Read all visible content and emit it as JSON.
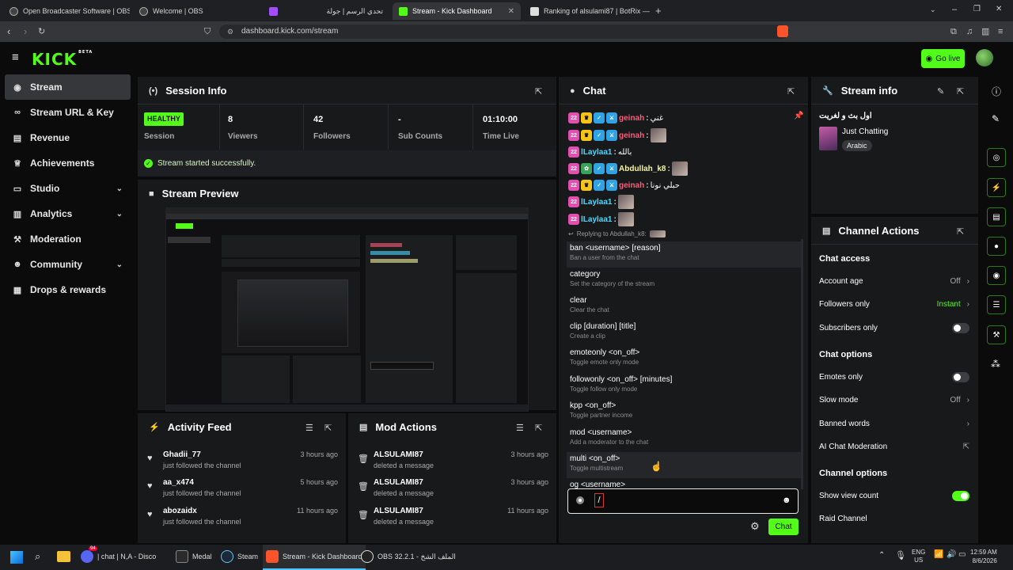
{
  "browser": {
    "tabs": [
      {
        "label": "Open Broadcaster Software | OBS"
      },
      {
        "label": "Welcome | OBS"
      },
      {
        "label": "تحدي الرسم | جولة"
      },
      {
        "label": "Stream - Kick Dashboard"
      },
      {
        "label": "Ranking of alsulami87 | BotRix — Clo"
      }
    ],
    "url": "dashboard.kick.com/stream"
  },
  "header": {
    "logo": "KICK",
    "logo_sup": "BETA",
    "go_live": "Go live"
  },
  "sidebar": {
    "items": [
      {
        "label": "Stream",
        "icon": "broadcast-icon"
      },
      {
        "label": "Stream URL & Key",
        "icon": "link-icon"
      },
      {
        "label": "Revenue",
        "icon": "chart-icon"
      },
      {
        "label": "Achievements",
        "icon": "trophy-icon"
      },
      {
        "label": "Studio",
        "icon": "studio-icon"
      },
      {
        "label": "Analytics",
        "icon": "analytics-icon"
      },
      {
        "label": "Moderation",
        "icon": "hammer-icon"
      },
      {
        "label": "Community",
        "icon": "people-icon"
      },
      {
        "label": "Drops & rewards",
        "icon": "gift-icon"
      }
    ]
  },
  "session": {
    "title": "Session Info",
    "health": "HEALTHY",
    "health_label": "Session",
    "stats": [
      {
        "value": "8",
        "label": "Viewers"
      },
      {
        "value": "42",
        "label": "Followers"
      },
      {
        "value": "-",
        "label": "Sub Counts"
      },
      {
        "value": "01:10:00",
        "label": "Time Live"
      }
    ],
    "notice": "Stream started successfully."
  },
  "preview": {
    "title": "Stream Preview"
  },
  "activity": {
    "title": "Activity Feed",
    "rows": [
      {
        "name": "Ghadii_77",
        "desc": "just followed the channel",
        "time": "3 hours ago"
      },
      {
        "name": "aa_x474",
        "desc": "just followed the channel",
        "time": "5 hours ago"
      },
      {
        "name": "abozaidx",
        "desc": "just followed the channel",
        "time": "11 hours ago"
      }
    ]
  },
  "mod_actions": {
    "title": "Mod Actions",
    "rows": [
      {
        "name": "ALSULAMI87",
        "desc": "deleted a message",
        "time": "3 hours ago"
      },
      {
        "name": "ALSULAMI87",
        "desc": "deleted a message",
        "time": "3 hours ago"
      },
      {
        "name": "ALSULAMI87",
        "desc": "deleted a message",
        "time": "11 hours ago"
      }
    ]
  },
  "chat": {
    "title": "Chat",
    "messages": [
      {
        "user": "geinah",
        "text": "غني",
        "color": "#ff5b7a"
      },
      {
        "user": "geinah",
        "text": "",
        "color": "#ff5b7a"
      },
      {
        "user": "lLaylaa1",
        "text": "بالله",
        "color": "#4ad8ff"
      },
      {
        "user": "Abdullah_k8",
        "text": "",
        "color": "#f4f4a0"
      },
      {
        "user": "geinah",
        "text": "حبلي نونا",
        "color": "#ff5b7a"
      },
      {
        "user": "lLaylaa1",
        "text": "",
        "color": "#4ad8ff"
      },
      {
        "user": "lLaylaa1",
        "text": "",
        "color": "#4ad8ff"
      }
    ],
    "replying": "Replying to Abdullah_k8:",
    "commands": [
      {
        "cmd": "ban <username> [reason]",
        "desc": "Ban a user from the chat"
      },
      {
        "cmd": "category",
        "desc": "Set the category of the stream"
      },
      {
        "cmd": "clear",
        "desc": "Clear the chat"
      },
      {
        "cmd": "clip [duration] [title]",
        "desc": "Create a clip"
      },
      {
        "cmd": "emoteonly <on_off>",
        "desc": "Toggle emote only mode"
      },
      {
        "cmd": "followonly <on_off> [minutes]",
        "desc": "Toggle follow only mode"
      },
      {
        "cmd": "kpp <on_off>",
        "desc": "Toggle partner income"
      },
      {
        "cmd": "mod <username>",
        "desc": "Add a moderator to the chat"
      },
      {
        "cmd": "multi <on_off>",
        "desc": "Toggle multistream"
      },
      {
        "cmd": "og <username>",
        "desc": ""
      }
    ],
    "input_value": "/",
    "send_label": "Chat"
  },
  "stream_info": {
    "title": "Stream info",
    "stream_title": "اول بث و لغريت",
    "category": "Just Chatting",
    "language": "Arabic"
  },
  "channel_actions": {
    "title": "Channel Actions",
    "chat_access": "Chat access",
    "account_age": "Account age",
    "account_age_val": "Off",
    "followers_only": "Followers only",
    "followers_only_val": "Instant",
    "subscribers_only": "Subscribers only",
    "chat_options": "Chat options",
    "emotes_only": "Emotes only",
    "slow_mode": "Slow mode",
    "slow_mode_val": "Off",
    "banned_words": "Banned words",
    "ai_moderation": "AI Chat Moderation",
    "channel_options": "Channel options",
    "show_view_count": "Show view count",
    "raid_channel": "Raid Channel"
  },
  "taskbar": {
    "discord": "| chat | N,A - Disco",
    "discord_badge": "94",
    "medal": "Medal",
    "steam": "Steam",
    "brave": "Stream - Kick Dashboard",
    "obs": "OBS 32.2.1 - الملف الشخ",
    "lang1": "ENG",
    "lang2": "US",
    "time": "12:59 AM",
    "date": "8/6/2026"
  },
  "colors": {
    "accent": "#53fc18",
    "panel": "#18191b",
    "bg": "#0b0b0c"
  }
}
